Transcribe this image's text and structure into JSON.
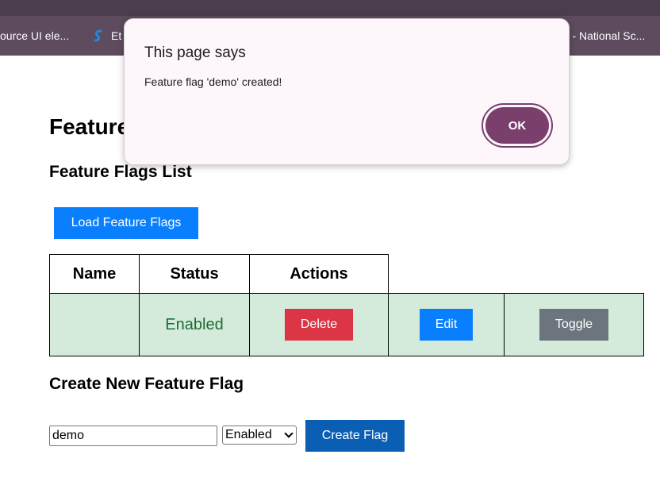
{
  "browser": {
    "bookmarks": [
      {
        "label": "ource UI ele..."
      },
      {
        "label": "Et"
      },
      {
        "label": "ne - National Sc..."
      }
    ]
  },
  "page": {
    "title": "Feature",
    "list_heading": "Feature Flags List",
    "load_button": "Load Feature Flags",
    "table": {
      "headers": [
        "Name",
        "Status",
        "Actions"
      ],
      "rows": [
        {
          "name": "",
          "status": "Enabled",
          "delete": "Delete",
          "edit": "Edit",
          "toggle": "Toggle"
        }
      ]
    },
    "create_heading": "Create New Feature Flag",
    "form": {
      "name_value": "demo",
      "status_selected": "Enabled",
      "create_button": "Create Flag"
    }
  },
  "dialog": {
    "title": "This page says",
    "message": "Feature flag 'demo' created!",
    "ok_label": "OK"
  },
  "colors": {
    "primary": "#0a7ffe",
    "danger": "#dc3545",
    "secondary": "#6c757d",
    "row_bg": "#d4ebdb",
    "status_text": "#1d6b35",
    "dialog_accent": "#7b3f6e"
  }
}
